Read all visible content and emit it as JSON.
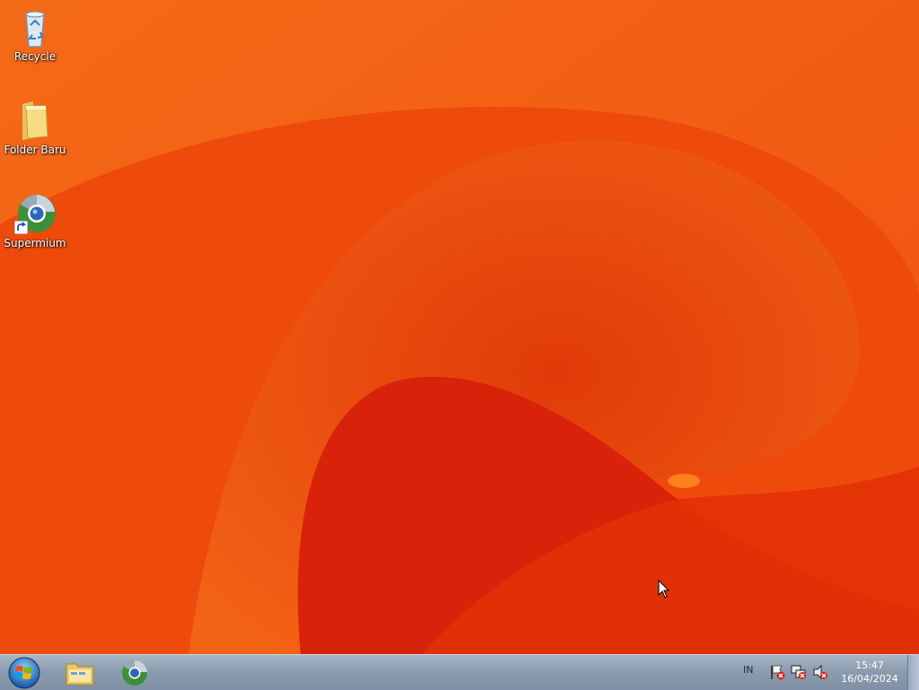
{
  "desktop": {
    "icons": [
      {
        "label": "Recycle",
        "icon": "recycle-bin-icon"
      },
      {
        "label": "Folder Baru",
        "icon": "folder-icon"
      },
      {
        "label": "Supermium",
        "icon": "supermium-browser-icon"
      }
    ],
    "wallpaper_colors": {
      "base": "#f04e0e",
      "dark": "#d21e06",
      "highlight": "#ff7a1e"
    }
  },
  "taskbar": {
    "start_icon": "windows-start-orb-icon",
    "pinned": [
      {
        "icon": "file-explorer-icon"
      },
      {
        "icon": "supermium-browser-icon"
      }
    ],
    "tray": {
      "language": "IN",
      "icons": [
        "action-center-flag-icon",
        "network-disconnected-icon",
        "volume-muted-icon"
      ]
    },
    "clock": {
      "time": "15:47",
      "date": "16/04/2024"
    }
  }
}
